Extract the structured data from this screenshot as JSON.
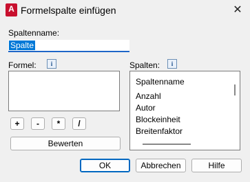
{
  "window": {
    "title": "Formelspalte einfügen",
    "app_icon_letter": "A"
  },
  "column_name": {
    "label": "Spaltenname:",
    "value": "Spalte"
  },
  "formula": {
    "label": "Formel:",
    "value": ""
  },
  "columns": {
    "label": "Spalten:",
    "header": "Spaltenname",
    "items": [
      "Anzahl",
      "Autor",
      "Blockeinheit",
      "Breitenfaktor"
    ]
  },
  "operators": [
    "+",
    "-",
    "*",
    "/"
  ],
  "buttons": {
    "evaluate": "Bewerten",
    "ok": "OK",
    "cancel": "Abbrechen",
    "help": "Hilfe"
  },
  "icons": {
    "info": "i",
    "close": "✕"
  }
}
